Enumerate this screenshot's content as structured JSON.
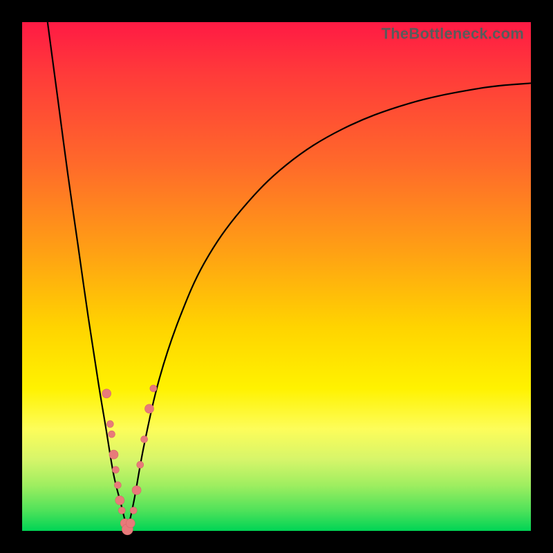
{
  "watermark": "TheBottleneck.com",
  "colors": {
    "frame_border": "#000000",
    "gradient_top": "#ff1a44",
    "gradient_mid": "#fff200",
    "gradient_bottom": "#00d455",
    "curve_stroke": "#000000",
    "bead_fill": "#e87a7a"
  },
  "chart_data": {
    "type": "line",
    "title": "",
    "xlabel": "",
    "ylabel": "",
    "xlim": [
      0,
      100
    ],
    "ylim": [
      0,
      100
    ],
    "series": [
      {
        "name": "left-branch",
        "x": [
          5,
          7,
          9,
          11,
          13,
          15,
          16.5,
          18,
          19.5,
          20.7
        ],
        "values": [
          100,
          85,
          70,
          56,
          42,
          29,
          20,
          11,
          5,
          0
        ]
      },
      {
        "name": "right-branch",
        "x": [
          20.7,
          22,
          24,
          27,
          31,
          36,
          43,
          52,
          63,
          76,
          90,
          100
        ],
        "values": [
          0,
          6,
          17,
          30,
          42,
          53,
          63,
          72,
          79,
          84,
          87,
          88
        ]
      }
    ],
    "markers": {
      "name": "beads",
      "points": [
        {
          "x": 16.6,
          "y": 27
        },
        {
          "x": 17.3,
          "y": 21
        },
        {
          "x": 17.6,
          "y": 19
        },
        {
          "x": 18.0,
          "y": 15
        },
        {
          "x": 18.4,
          "y": 12
        },
        {
          "x": 18.8,
          "y": 9
        },
        {
          "x": 19.2,
          "y": 6
        },
        {
          "x": 19.6,
          "y": 4
        },
        {
          "x": 20.2,
          "y": 1.5
        },
        {
          "x": 20.7,
          "y": 0.3
        },
        {
          "x": 21.3,
          "y": 1.5
        },
        {
          "x": 21.9,
          "y": 4
        },
        {
          "x": 22.5,
          "y": 8
        },
        {
          "x": 23.2,
          "y": 13
        },
        {
          "x": 24.0,
          "y": 18
        },
        {
          "x": 25.0,
          "y": 24
        },
        {
          "x": 25.8,
          "y": 28
        }
      ]
    }
  }
}
